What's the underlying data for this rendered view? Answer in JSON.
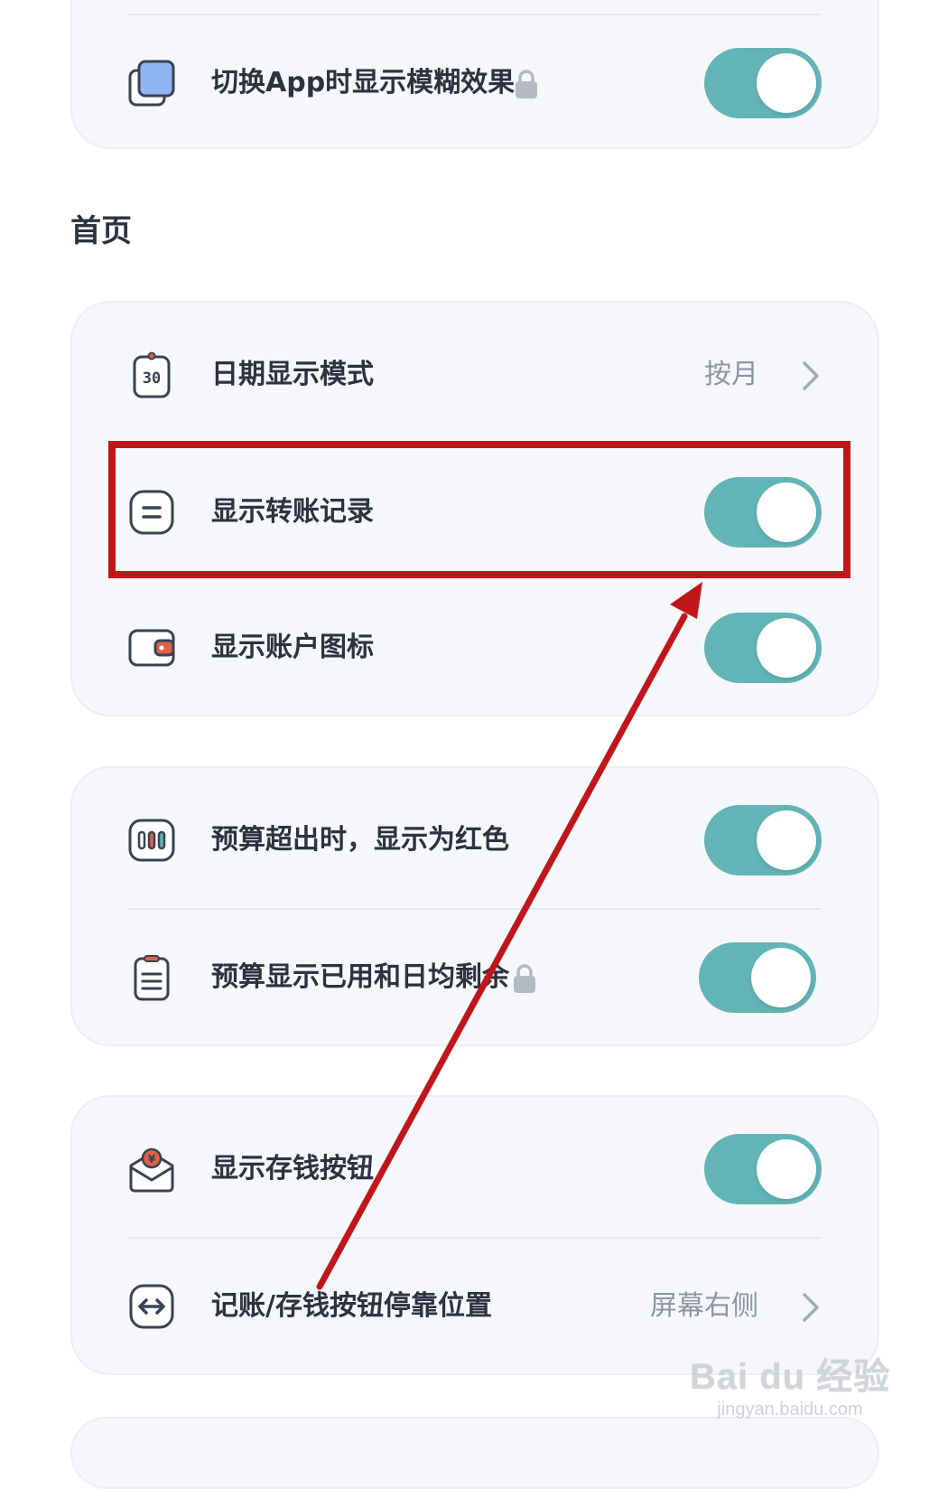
{
  "colors": {
    "toggle_on": "#62b4b6",
    "card_bg": "#f6f7fa",
    "label_text": "#2b3240",
    "value_text": "#8c94a3",
    "annotation": "#c0161b"
  },
  "top_card": {
    "rows": [
      {
        "icon": "layers-icon",
        "label": "切换App时显示模糊效果",
        "locked": true,
        "toggle_on": true
      }
    ]
  },
  "section_home": {
    "title": "首页"
  },
  "home_card": {
    "rows": [
      {
        "icon": "calendar-icon",
        "label": "日期显示模式",
        "value": "按月"
      },
      {
        "icon": "transfer-record-icon",
        "label": "显示转账记录",
        "toggle_on": true
      },
      {
        "icon": "wallet-icon",
        "label": "显示账户图标",
        "toggle_on": true
      }
    ]
  },
  "budget_card": {
    "rows": [
      {
        "icon": "budget-bars-icon",
        "label": "预算超出时，显示为红色",
        "toggle_on": true
      },
      {
        "icon": "clipboard-icon",
        "label": "预算显示已用和日均剩余",
        "locked": true,
        "toggle_on": true
      }
    ]
  },
  "savings_card": {
    "rows": [
      {
        "icon": "savings-envelope-icon",
        "label": "显示存钱按钮",
        "toggle_on": true
      },
      {
        "icon": "swap-horizontal-icon",
        "label": "记账/存钱按钮停靠位置",
        "value": "屏幕右侧"
      }
    ]
  },
  "watermark": {
    "main": "Bai du 经验",
    "sub": "jingyan.baidu.com"
  }
}
